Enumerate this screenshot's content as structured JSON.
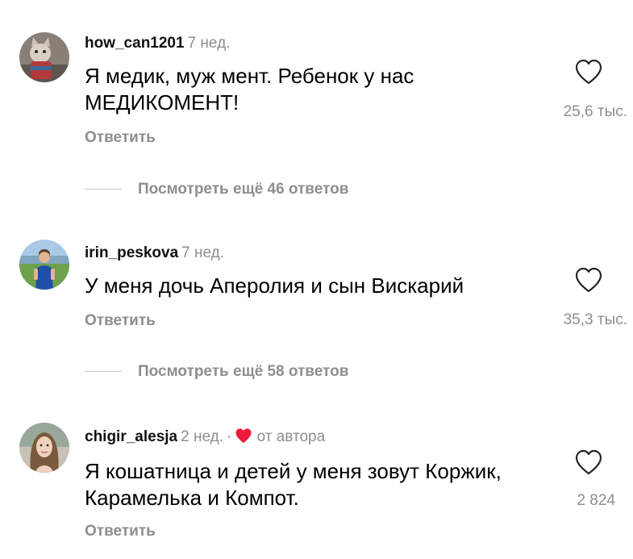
{
  "comments": [
    {
      "username": "how_can1201",
      "time": "7 нед.",
      "text": "Я медик, муж мент. Ребенок у нас МЕДИКОМЕНТ!",
      "likes": "25,6 тыс.",
      "reply_label": "Ответить",
      "view_replies": "Посмотреть ещё 46 ответов",
      "avatar_icon": "cat-avatar"
    },
    {
      "username": "irin_peskova",
      "time": "7 нед.",
      "text": "У меня дочь Аперолия и сын Вискарий",
      "likes": "35,3 тыс.",
      "reply_label": "Ответить",
      "view_replies": "Посмотреть ещё 58 ответов",
      "avatar_icon": "woman-outdoor-avatar"
    },
    {
      "username": "chigir_alesja",
      "time": "2 нед.",
      "separator": "·",
      "author_badge": "от автора",
      "text": "Я кошатница и детей у меня зовут Коржик, Карамелька и Компот.",
      "likes": "2 824",
      "reply_label": "Ответить",
      "avatar_icon": "woman-portrait-avatar"
    }
  ],
  "colors": {
    "secondary_text": "#8e8e8e",
    "author_heart": "#ed1c3a",
    "like_icon_stroke": "#262626"
  }
}
